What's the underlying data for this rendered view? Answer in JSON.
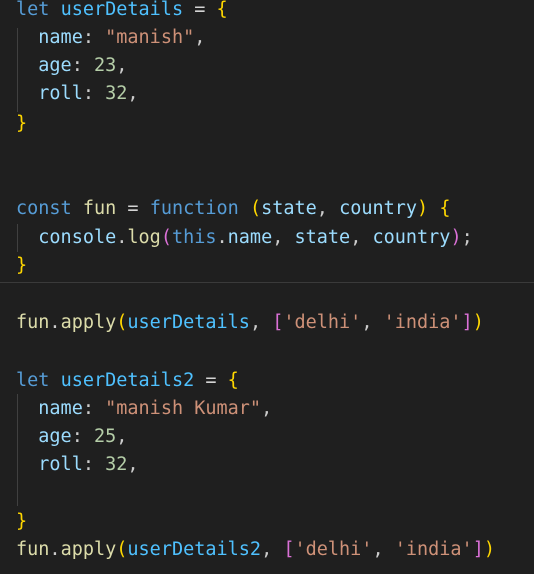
{
  "code": {
    "l1": {
      "kw": "let",
      "name": "userDetails",
      "eq": "=",
      "open": "{"
    },
    "l2": {
      "prop": "name",
      "colon": ":",
      "value": "\"manish\"",
      "comma": ","
    },
    "l3": {
      "prop": "age",
      "colon": ":",
      "value": "23",
      "comma": ","
    },
    "l4": {
      "prop": "roll",
      "colon": ":",
      "value": "32",
      "comma": ","
    },
    "l5": {
      "close": "}"
    },
    "l6": {
      "kw": "const",
      "name": "fun",
      "eq": "=",
      "fnkw": "function",
      "po": "(",
      "p1": "state",
      "c1": ",",
      "p2": "country",
      "pc": ")",
      "open": "{"
    },
    "l7": {
      "obj": "console",
      "dot": ".",
      "method": "log",
      "po": "(",
      "this": "this",
      "dot2": ".",
      "prop": "name",
      "c1": ",",
      "a2": "state",
      "c2": ",",
      "a3": "country",
      "pc": ")",
      "semi": ";"
    },
    "l8": {
      "close": "}"
    },
    "l9": {
      "obj": "fun",
      "dot": ".",
      "method": "apply",
      "po": "(",
      "arg": "userDetails",
      "c1": ",",
      "bo": "[",
      "s1": "'delhi'",
      "c2": ",",
      "s2": "'india'",
      "bc": "]",
      "pc": ")"
    },
    "l10": {
      "kw": "let",
      "name": "userDetails2",
      "eq": "=",
      "open": "{"
    },
    "l11": {
      "prop": "name",
      "colon": ":",
      "value": "\"manish Kumar\"",
      "comma": ","
    },
    "l12": {
      "prop": "age",
      "colon": ":",
      "value": "25",
      "comma": ","
    },
    "l13": {
      "prop": "roll",
      "colon": ":",
      "value": "32",
      "comma": ","
    },
    "l14": {
      "close": "}"
    },
    "l15": {
      "obj": "fun",
      "dot": ".",
      "method": "apply",
      "po": "(",
      "arg": "userDetails2",
      "c1": ",",
      "bo": "[",
      "s1": "'delhi'",
      "c2": ",",
      "s2": "'india'",
      "bc": "]",
      "pc": ")"
    }
  },
  "colors": {
    "background": "#1f1f1f",
    "keyword": "#569cd6",
    "variable": "#4fc1ff",
    "property": "#9cdcfe",
    "function": "#dcdcaa",
    "string": "#ce9178",
    "number": "#b5cea8",
    "bracket_level1": "#ffd700",
    "bracket_level2": "#da70d6",
    "bracket_level3": "#179fff"
  }
}
